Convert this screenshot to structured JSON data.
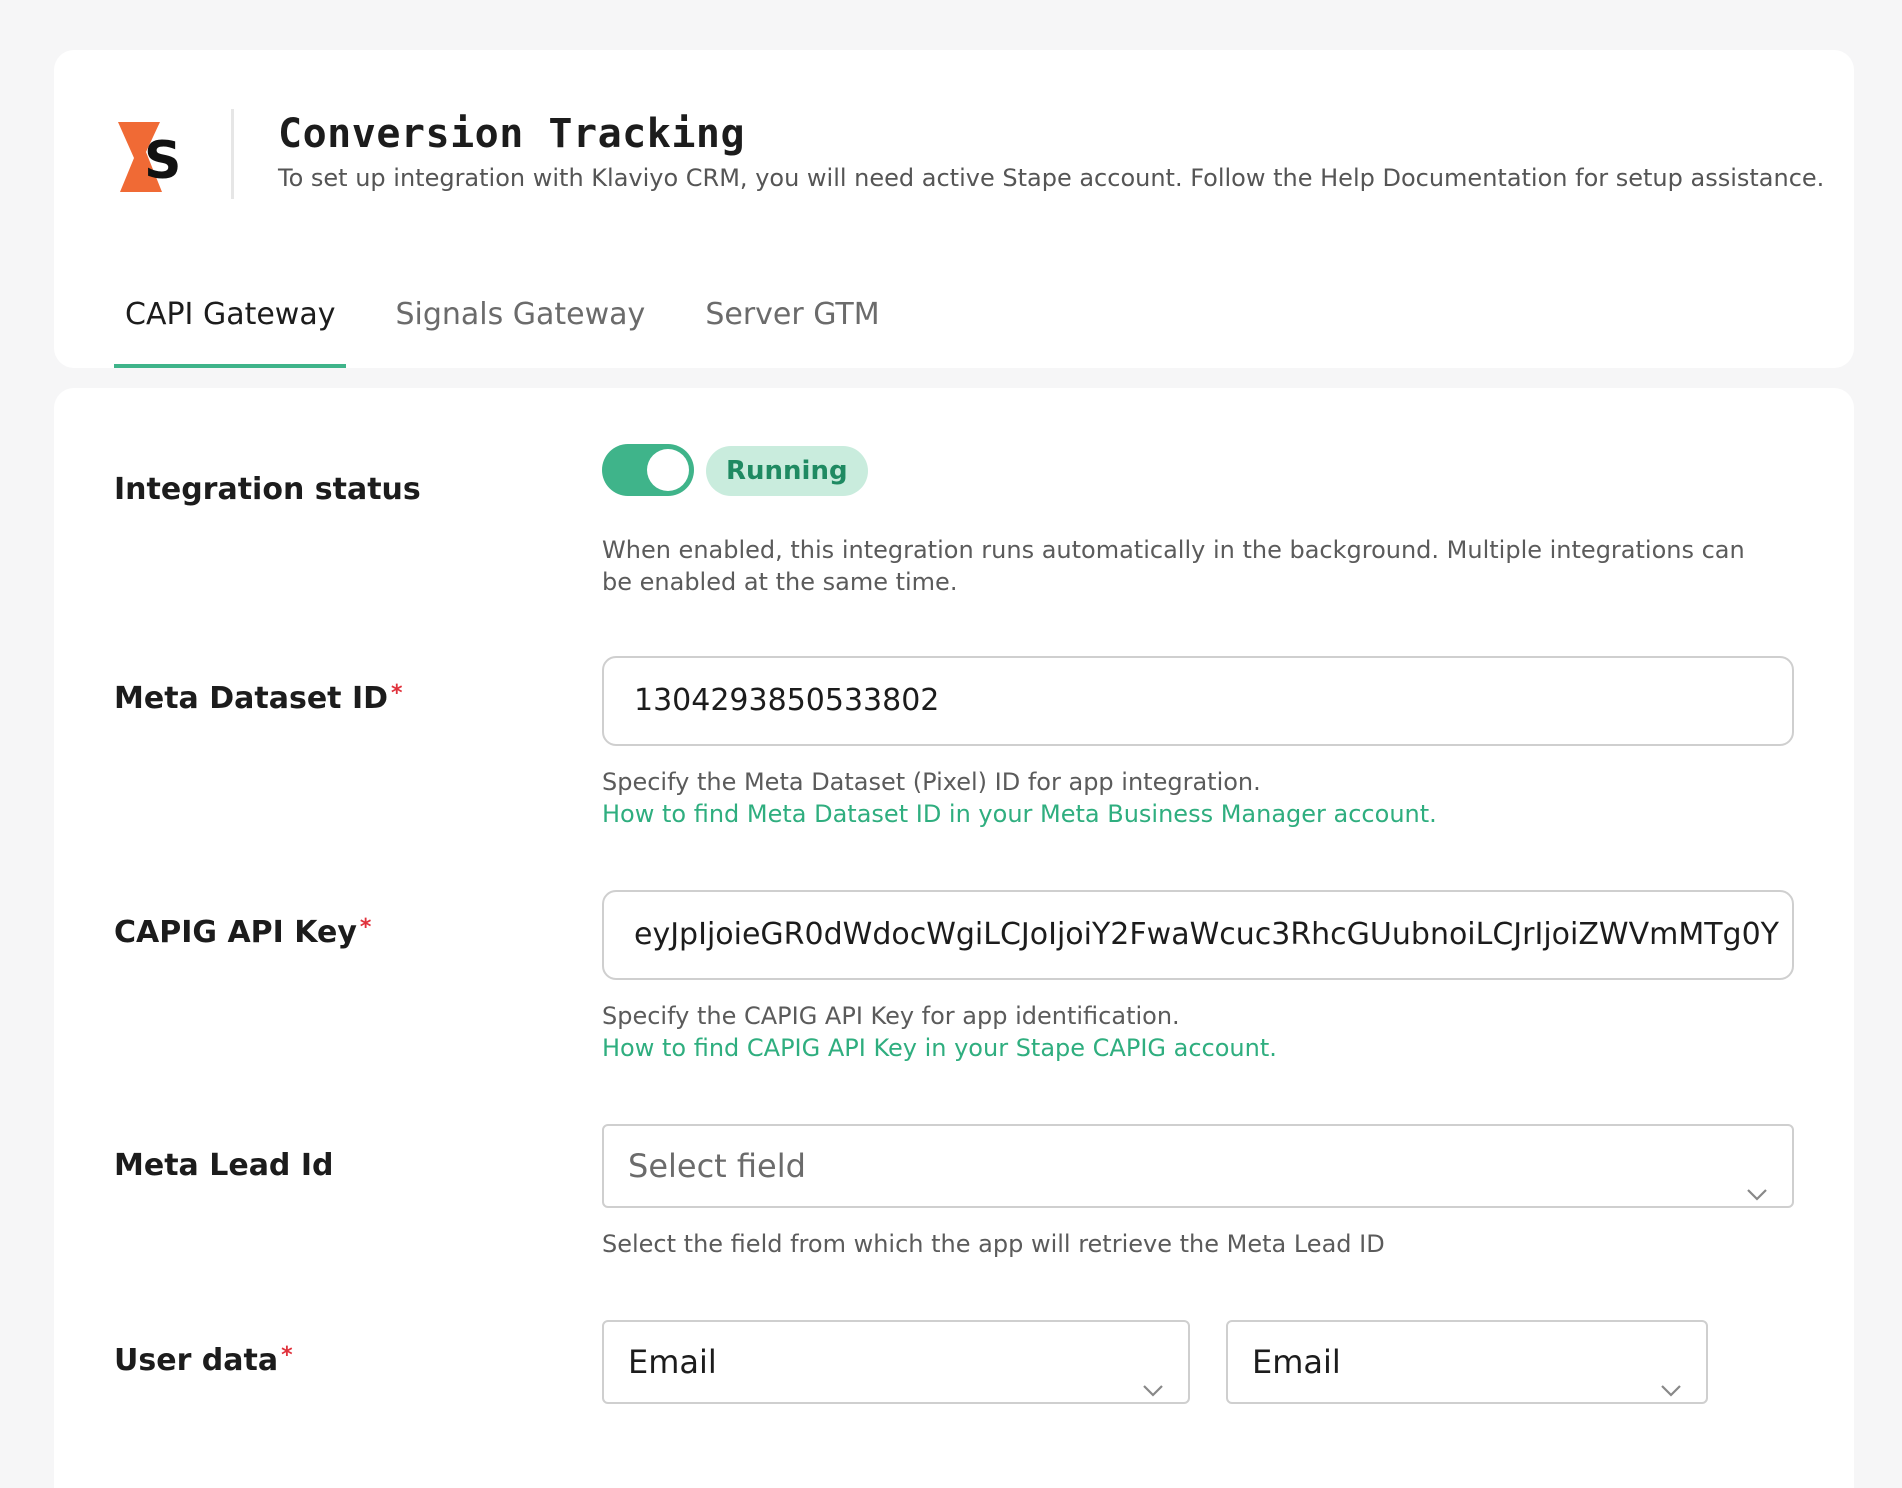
{
  "header": {
    "title": "Conversion Tracking",
    "subtitle": "To set up integration with Klaviyo CRM, you will need active Stape account. Follow the Help Documentation for setup assistance.",
    "logo_icon": "stape-logo-icon",
    "brand_colors": {
      "logo_orange": "#f06a35",
      "accent": "#3fb48a"
    }
  },
  "tabs": [
    {
      "label": "CAPI Gateway",
      "active": true
    },
    {
      "label": "Signals Gateway",
      "active": false
    },
    {
      "label": "Server GTM",
      "active": false
    }
  ],
  "form": {
    "integration_status": {
      "label": "Integration status",
      "toggle_on": true,
      "badge": "Running",
      "help": "When enabled, this integration runs automatically in the background. Multiple integrations can be enabled at the same time."
    },
    "dataset_id": {
      "label": "Meta Dataset ID",
      "required_mark": "*",
      "value": "1304293850533802",
      "help": "Specify the Meta Dataset (Pixel) ID for app integration.",
      "link": "How to find Meta Dataset ID in your Meta Business Manager account."
    },
    "api_key": {
      "label": "CAPIG API Key",
      "required_mark": "*",
      "value": "eyJpIjoieGR0dWdocWgiLCJoIjoiY2FwaWcuc3RhcGUubnoiLCJrIjoiZWVmMTg0Y",
      "help": "Specify the CAPIG API Key for app identification.",
      "link": "How to find CAPIG API Key in your Stape CAPIG account."
    },
    "lead_id": {
      "label": "Meta Lead Id",
      "placeholder": "Select field",
      "help": "Select the field from which the app will retrieve the Meta Lead ID"
    },
    "user_data": {
      "label": "User data",
      "required_mark": "*",
      "select_1": "Email",
      "select_2": "Email"
    }
  }
}
